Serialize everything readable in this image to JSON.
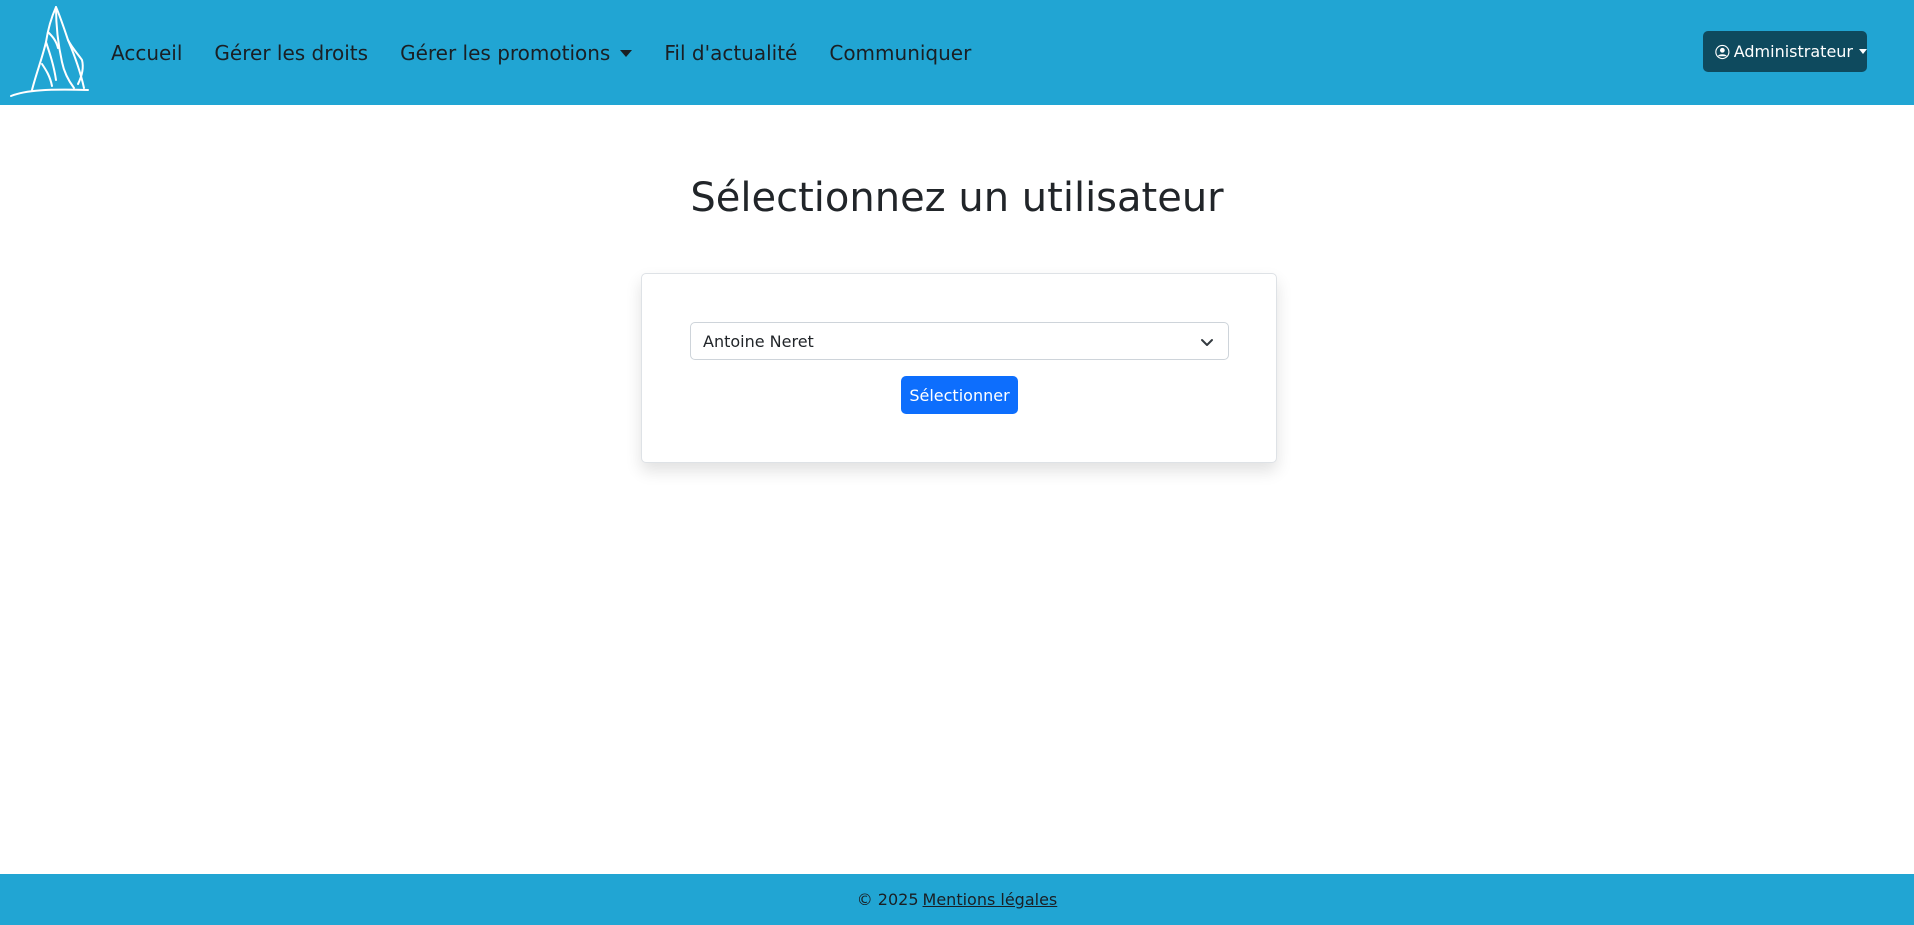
{
  "header": {
    "logo": "praying-hands-logo",
    "nav": [
      {
        "label": "Accueil"
      },
      {
        "label": "Gérer les droits"
      },
      {
        "label": "Gérer les promotions",
        "has_dropdown": true
      },
      {
        "label": "Fil d'actualité"
      },
      {
        "label": "Communiquer"
      }
    ],
    "user_menu": {
      "label": "Administrateur",
      "icon": "user-circle-icon"
    }
  },
  "main": {
    "title": "Sélectionnez un utilisateur",
    "user_select": {
      "selected_value": "Antoine Neret",
      "icon": "chevron-down-icon"
    },
    "submit_label": "Sélectionner"
  },
  "footer": {
    "copyright": "© 2025",
    "legal_link": "Mentions légales"
  },
  "colors": {
    "header_bg": "#21a5d3",
    "footer_bg": "#21a5d3",
    "admin_button_bg": "#0e4a5e",
    "primary_button_bg": "#0d6efd"
  }
}
